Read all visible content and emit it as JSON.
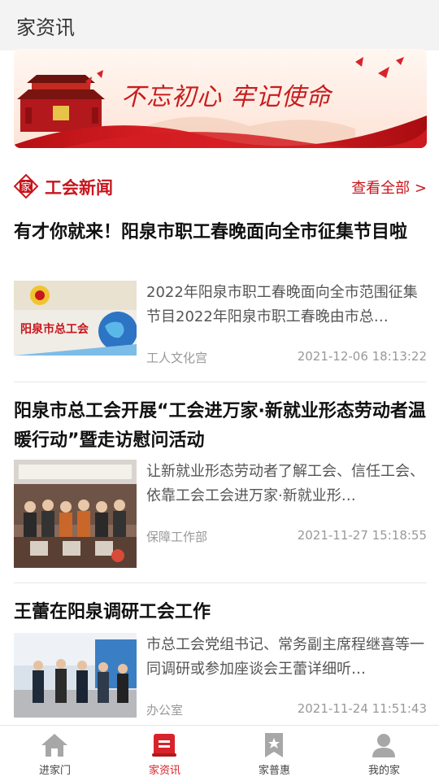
{
  "header": {
    "title": "家资讯"
  },
  "banner": {
    "slogan": "不忘初心  牢记使命"
  },
  "section": {
    "icon_char": "家",
    "title": "工会新闻",
    "see_all": "查看全部 >"
  },
  "articles": [
    {
      "title": "有才你就来！阳泉市职工春晚面向全市征集节目啦",
      "summary": "2022年阳泉市职工春晚面向全市范围征集节目2022年阳泉市职工春晚由市总…",
      "source": "工人文化宫",
      "date": "2021-12-06 18:13:22",
      "thumb_text": "阳泉市总工会"
    },
    {
      "title": "阳泉市总工会开展“工会进万家·新就业形态劳动者温暖行动”暨走访慰问活动",
      "summary": "让新就业形态劳动者了解工会、信任工会、依靠工会工会进万家·新就业形…",
      "source": "保障工作部",
      "date": "2021-11-27 15:18:55"
    },
    {
      "title": "王蕾在阳泉调研工会工作",
      "summary": "市总工会党组书记、常务副主席程继喜等一同调研或参加座谈会王蕾详细听…",
      "source": "办公室",
      "date": "2021-11-24 11:51:43"
    }
  ],
  "tabs": [
    {
      "label": "进家门",
      "icon": "home-icon"
    },
    {
      "label": "家资讯",
      "icon": "news-icon",
      "active": true
    },
    {
      "label": "家普惠",
      "icon": "bookmark-star-icon"
    },
    {
      "label": "我的家",
      "icon": "person-icon"
    }
  ],
  "colors": {
    "brand": "#c8161d",
    "active_tab": "#d8232a"
  }
}
